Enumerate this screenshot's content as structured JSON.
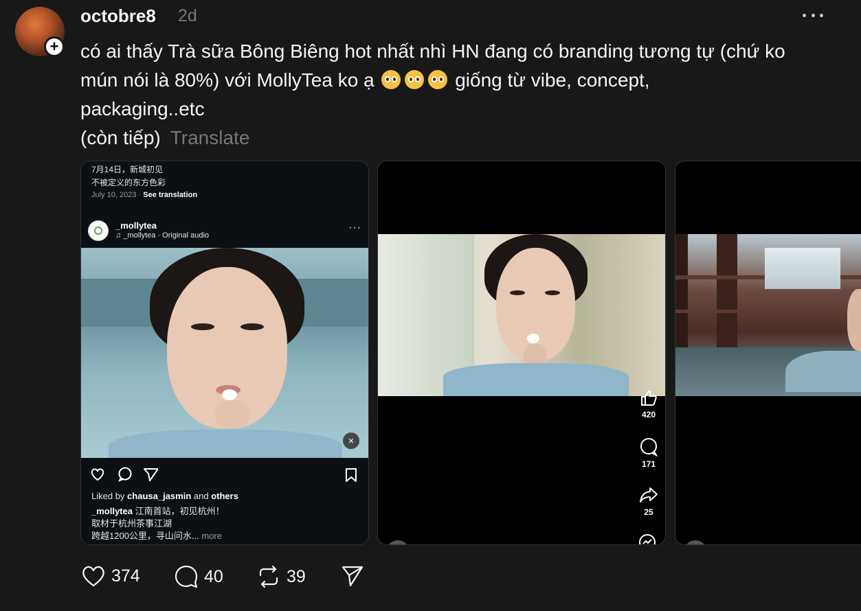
{
  "post": {
    "username": "octobre8",
    "time": "2d",
    "text_line1": "có ai thấy Trà sữa Bông Biêng hot nhất nhì HN đang có branding tương tự (chứ ko",
    "text_line2a": "mún nói là 80%) với MollyTea ko ạ",
    "text_line2b": "giống từ vibe, concept,",
    "text_line3": "packaging..etc",
    "text_line4": "(còn tiếp)",
    "translate_label": "Translate",
    "emoji_name": "pleading-face-emoji"
  },
  "card1": {
    "caption_top1": "7月14日，新城初见",
    "caption_top2": "不被定义的东方色彩",
    "date": "July 10, 2023",
    "see_translation": "See translation",
    "account": "_mollytea",
    "audio": "_mollytea · Original audio",
    "liked_by_prefix": "Liked by",
    "liked_by_user": "chausa_jasmin",
    "liked_by_and": "and",
    "liked_by_others": "others",
    "cap_user": "_mollytea",
    "cap_line1": "江南首站，初见杭州！",
    "cap_line2": "取材于杭州茶事江湖",
    "cap_line3": "跨越1200公里，寻山问水...",
    "more": "more"
  },
  "card2": {
    "likes": "420",
    "comments": "171",
    "shares": "25"
  },
  "actions": {
    "likes": "374",
    "replies": "40",
    "reposts": "39"
  },
  "colors": {
    "background": "#181818",
    "text": "#f3f5f7",
    "muted": "#777777"
  }
}
